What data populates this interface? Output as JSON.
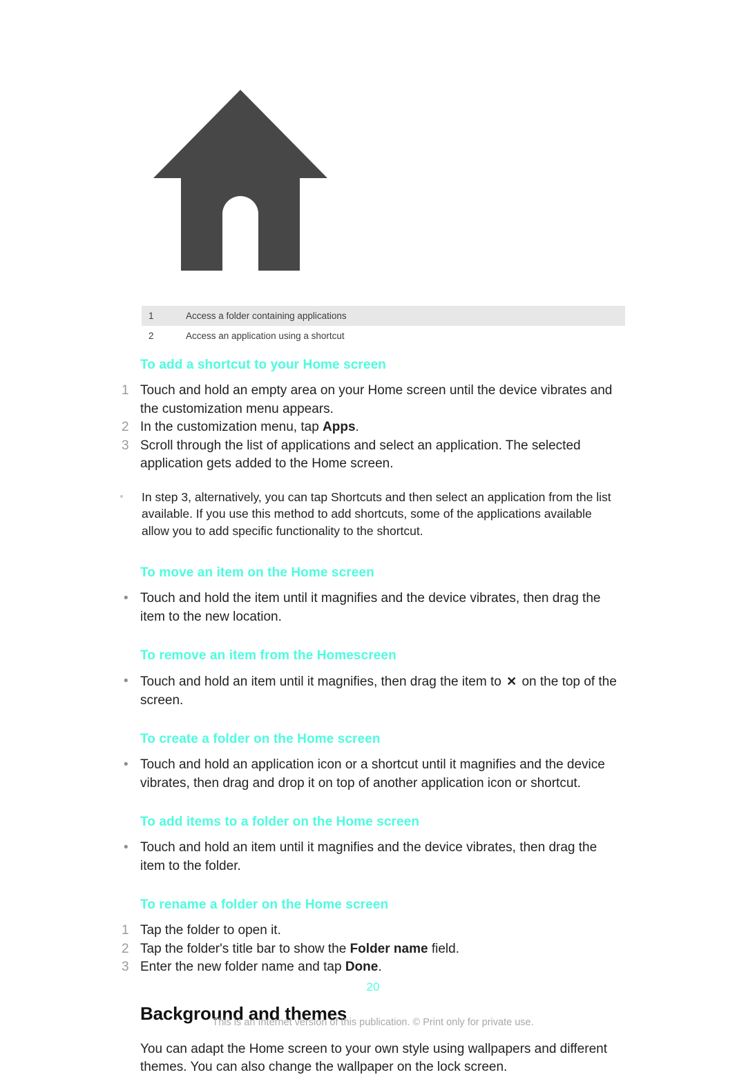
{
  "figure": {
    "icon": "home-icon",
    "color": "#474747"
  },
  "legend": {
    "rows": [
      {
        "number": "1",
        "description": "Access a folder containing applications"
      },
      {
        "number": "2",
        "description": "Access an application using a shortcut"
      }
    ]
  },
  "sections": {
    "add_shortcut": {
      "heading": "To add a shortcut to your Home screen",
      "steps": [
        {
          "marker": "1",
          "text": "Touch and hold an empty area on your Home screen until the device vibrates and the customization menu appears."
        },
        {
          "marker": "2",
          "prefix": "In the customization menu, tap ",
          "bold": "Apps",
          "suffix": "."
        },
        {
          "marker": "3",
          "text": "Scroll through the list of applications and select an application. The selected application gets added to the Home screen."
        }
      ],
      "note": "In step 3, alternatively, you can tap Shortcuts and then select an application from the list available. If you use this method to add shortcuts, some of the applications available allow you to add specific functionality to the shortcut."
    },
    "move_item": {
      "heading": "To move an item on the Home screen",
      "bullet_marker": "•",
      "bullet": "Touch and hold the item until it magnifies and the device vibrates, then drag the item to the new location."
    },
    "remove_item": {
      "heading": "To remove an item from the Homescreen",
      "bullet_marker": "•",
      "bullet_prefix": "Touch and hold an item until it magnifies, then drag the item to ",
      "bullet_icon": "✕",
      "bullet_icon_name": "close-icon",
      "bullet_suffix": " on the top of the screen."
    },
    "create_folder": {
      "heading": "To create a folder on the Home screen",
      "bullet_marker": "•",
      "bullet": "Touch and hold an application icon or a shortcut until it magnifies and the device vibrates, then drag and drop it on top of another application icon or shortcut."
    },
    "add_items_folder": {
      "heading": "To add items to a folder on the Home screen",
      "bullet_marker": "•",
      "bullet": "Touch and hold an item until it magnifies and the device vibrates, then drag the item to the folder."
    },
    "rename_folder": {
      "heading": "To rename a folder on the Home screen",
      "steps": [
        {
          "marker": "1",
          "text": "Tap the folder to open it."
        },
        {
          "marker": "2",
          "prefix": "Tap the folder's title bar to show the ",
          "bold": "Folder name",
          "suffix": " field."
        },
        {
          "marker": "3",
          "prefix": "Enter the new folder name and tap ",
          "bold": "Done",
          "suffix": "."
        }
      ]
    },
    "background_themes": {
      "heading": "Background and themes",
      "paragraph": "You can adapt the Home screen to your own style using wallpapers and different themes. You can also change the wallpaper on the lock screen."
    }
  },
  "footer": {
    "page_number": "20",
    "notice": "This is an Internet version of this publication. © Print only for private use."
  },
  "colors": {
    "heading_cyan": "#4ffbdf",
    "body_text": "#231f20",
    "legend_shade": "#e7e7e7",
    "marker_gray": "#9a9a9a"
  }
}
